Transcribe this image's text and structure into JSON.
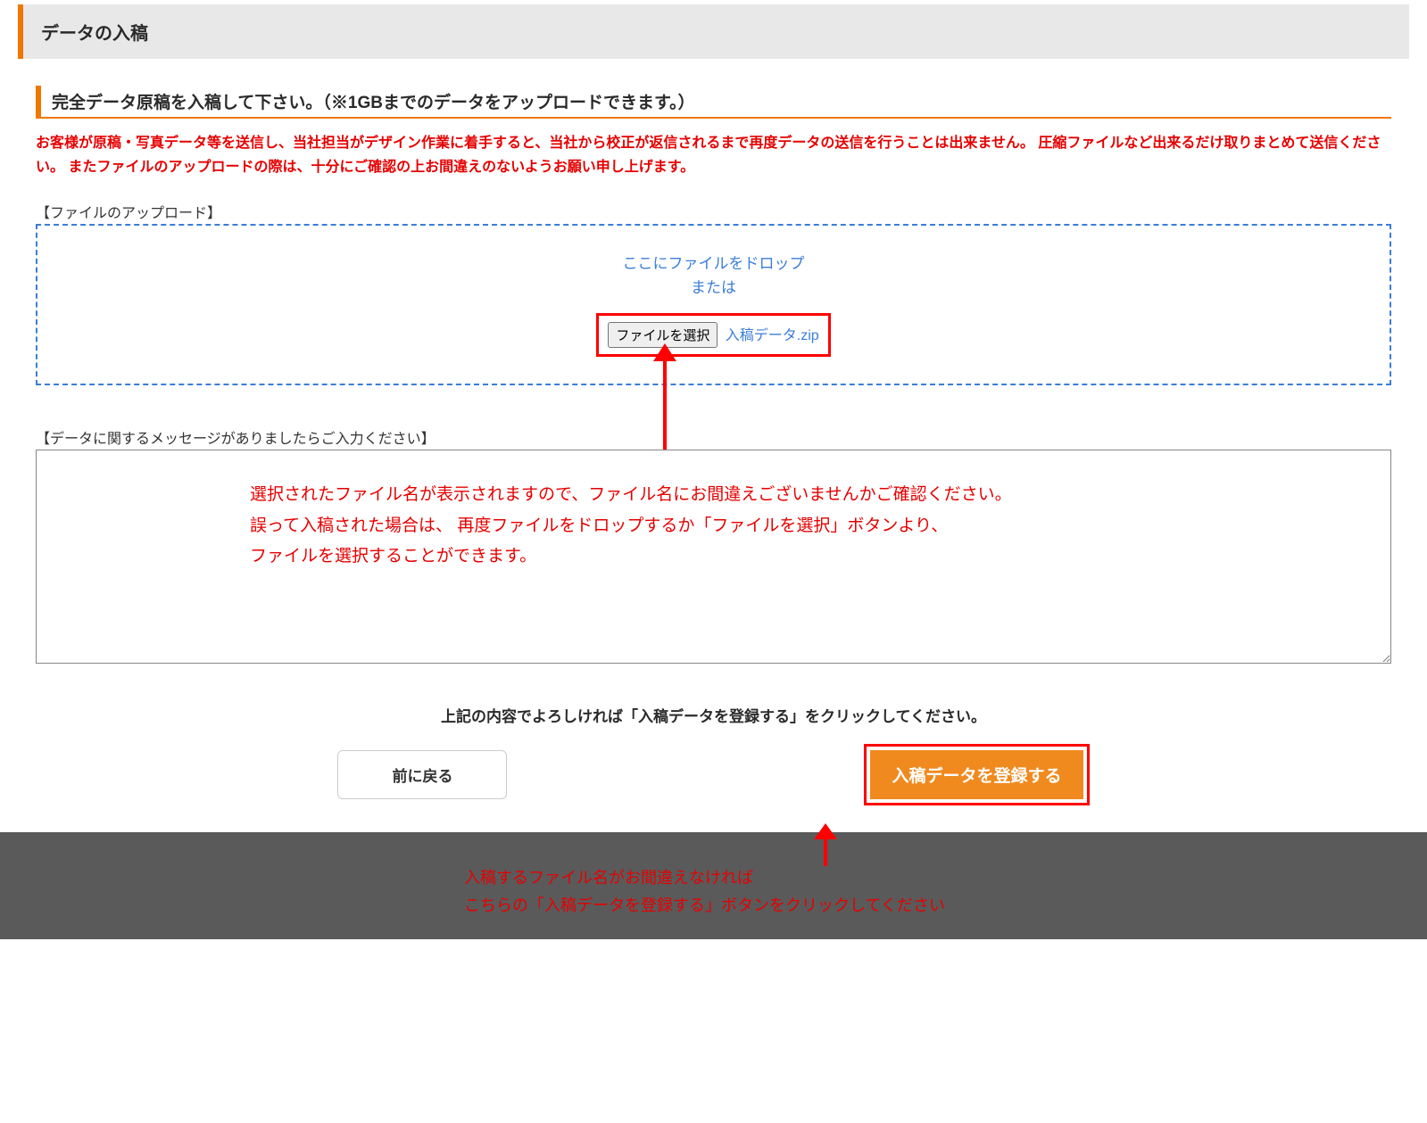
{
  "header": {
    "title": "データの入稿"
  },
  "section": {
    "title": "完全データ原稿を入稿して下さい。（※1GBまでのデータをアップロードできます。）"
  },
  "warning": "お客様が原稿・写真データ等を送信し、当社担当がデザイン作業に着手すると、当社から校正が返信されるまで再度データの送信を行うことは出来ません。 圧縮ファイルなど出来るだけ取りまとめて送信ください。 またファイルのアップロードの際は、十分にご確認の上お間違えのないようお願い申し上げます。",
  "upload": {
    "fieldset_label": "【ファイルのアップロード】",
    "drop_text": "ここにファイルをドロップ",
    "or_text": "または",
    "select_button": "ファイルを選択",
    "selected_filename": "入稿データ.zip"
  },
  "message": {
    "fieldset_label": "【データに関するメッセージがありましたらご入力ください】"
  },
  "annotation1": {
    "line1": "選択されたファイル名が表示されますので、ファイル名にお間違えございませんかご確認ください。",
    "line2": "誤って入稿された場合は、 再度ファイルをドロップするか「ファイルを選択」ボタンより、",
    "line3": "ファイルを選択することができます。"
  },
  "submit": {
    "prompt": "上記の内容でよろしければ「入稿データを登録する」をクリックしてください。",
    "back_button": "前に戻る",
    "submit_button": "入稿データを登録する"
  },
  "annotation2": {
    "line1": "入稿するファイル名がお間違えなければ",
    "line2": "こちらの「入稿データを登録する」ボタンをクリックしてください"
  }
}
